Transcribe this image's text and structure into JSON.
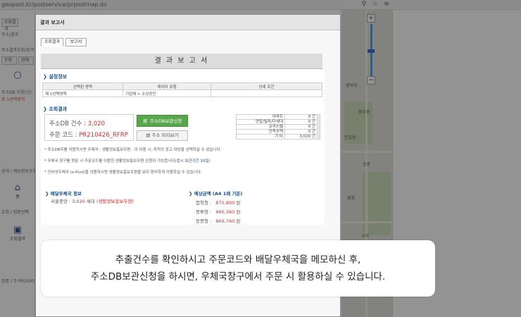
{
  "browser": {
    "url": "geopost.kr/postservice/prpostmap.do",
    "icon_pin": "location-pin-icon",
    "icon_star": "star-icon",
    "icon_menu": "menu-icon"
  },
  "background_panel": {
    "tab_a": "조회결과",
    "row1": "주소/결과",
    "row2": "주소결과조회/검색",
    "row3": "조회/전체 건",
    "tab_b": "조회",
    "tab_c": "전체",
    "row4": "주소DB 지정(건)",
    "row5": "주 1선택영역",
    "row6": "검색 / 배송정보조회",
    "big1_label": "홈",
    "row7": "조회 / 집중선택",
    "big2_label": "조회결과",
    "row8": "집중 / 주 PR2005"
  },
  "map": {
    "labels": [
      "원보당",
      "원수동",
      "한일성",
      "승광",
      "흥정",
      "우리"
    ]
  },
  "dialog": {
    "title": "결과 보고서",
    "tabs": [
      "조회결과",
      "보고서"
    ],
    "report_title": "결 과 보 고 서",
    "settings": {
      "heading": "설정정보",
      "headers": [
        "선택된 영역",
        "데이터 유형",
        "상세 조건"
      ],
      "row": [
        "제 1선택영역",
        "기업체 > 소상공인",
        ""
      ]
    },
    "result": {
      "heading": "조회결과",
      "count_label": "주소DB 건수 : ",
      "count_value": "3,020",
      "order_label": "주문 코드 : ",
      "order_value": "PR210426_RFRP",
      "btn_apply": "주소DB보관신청",
      "btn_preview": "주소 미리보기",
      "stats": [
        {
          "k": "아파트",
          "v": "0 건"
        },
        {
          "k": "연립/빌라/다세대",
          "v": "0 건"
        },
        {
          "k": "오피스텔",
          "v": "0 건"
        },
        {
          "k": "단독주택",
          "v": "0 건"
        },
        {
          "k": "기 타",
          "v": "3,020 건"
        }
      ],
      "note1": "* 주소DB주를 이용하시면 우체국 · 생활정보홍보우편 ‧ 의 이용 시, 최적의 광고 대상을 선택하실 수 있습니다.",
      "note2_pre": "* 우체국 창구를 방문 시 주문코드를 이용한 생활정보홍보우편 신청이 가능합니다(접시 ",
      "note2_hl": "보관기간 10일",
      "note2_post": ")",
      "note3": "* 인터넷우체국 (e-Post)을 이용하시면 생활정보홍보우편을 보다 편리하게 이용하실 수 있습니다."
    },
    "delivery": {
      "heading": "배달우체국 정보",
      "office": "서울중앙 : ",
      "office_count": "3,020",
      "office_unit": " 세대 ",
      "office_tag": "(생활정보홍보우편)"
    },
    "estimate": {
      "heading": "예상금액 (A4 1매 기준)",
      "rows": [
        {
          "k": "접착형 :",
          "v": "875,800",
          "u": " 원"
        },
        {
          "k": "봉투형 :",
          "v": "960,360",
          "u": " 원"
        },
        {
          "k": "동봉형 :",
          "v": "869,760",
          "u": " 원"
        }
      ]
    }
  },
  "callout": {
    "line1": "추출건수를 확인하시고 주문코드와 배달우체국을 메모하신 후,",
    "line2": "주소DB보관신청을 하시면, 우체국창구에서 주문 시 활용하실 수 있습니다."
  }
}
